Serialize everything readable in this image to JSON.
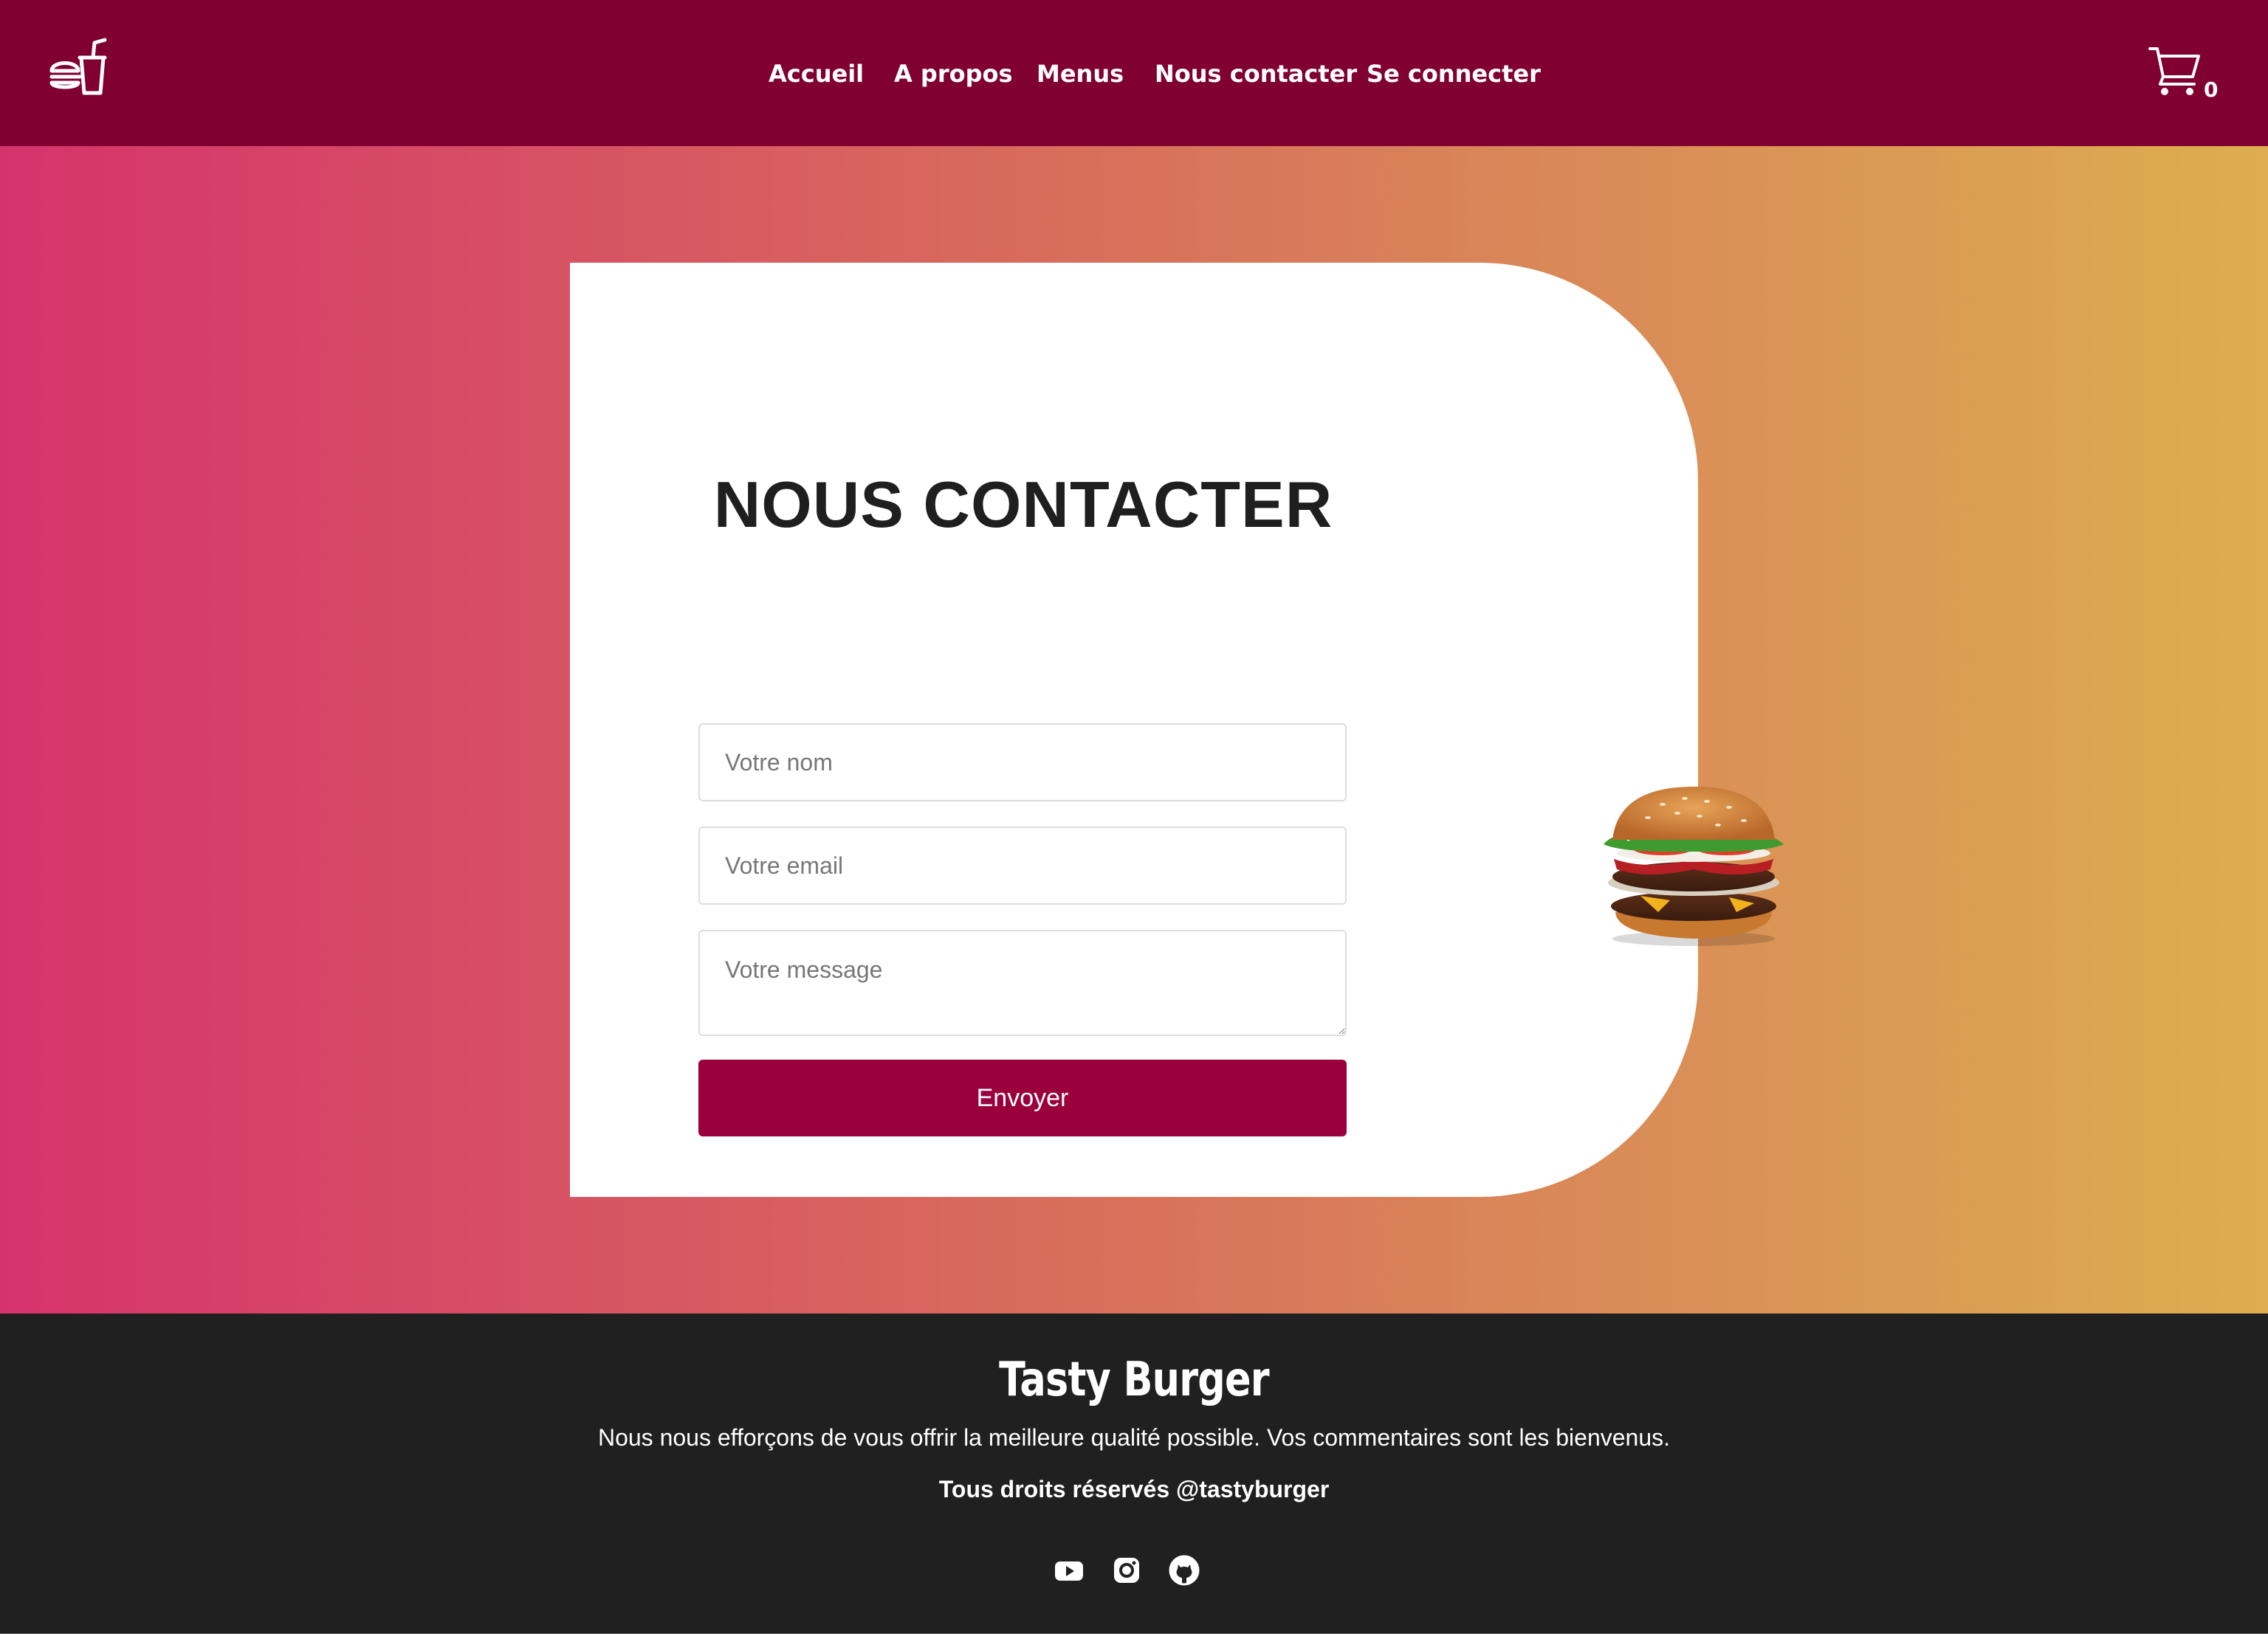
{
  "header": {
    "logo_icon": "burger-drink-icon",
    "nav": [
      "Accueil",
      "A propos",
      "Menus",
      "Nous contacter",
      "Se connecter"
    ],
    "cart_icon": "cart-icon",
    "cart_count": "0"
  },
  "contact": {
    "title": "NOUS CONTACTER",
    "name_placeholder": "Votre nom",
    "email_placeholder": "Votre email",
    "message_placeholder": "Votre message",
    "submit_label": "Envoyer",
    "image": "burger-image"
  },
  "footer": {
    "brand": "Tasty Burger",
    "tagline": "Nous nous efforçons de vous offrir la meilleure qualité possible. Vos commentaires sont les bienvenus.",
    "rights": "Tous droits réservés @tastyburger",
    "social": [
      "youtube-icon",
      "instagram-icon",
      "github-icon"
    ]
  },
  "colors": {
    "header_bg": "#800031",
    "button_bg": "#9b003d",
    "footer_bg": "#202020",
    "gradient_start": "#d6336c",
    "gradient_end": "#dcae4f"
  }
}
